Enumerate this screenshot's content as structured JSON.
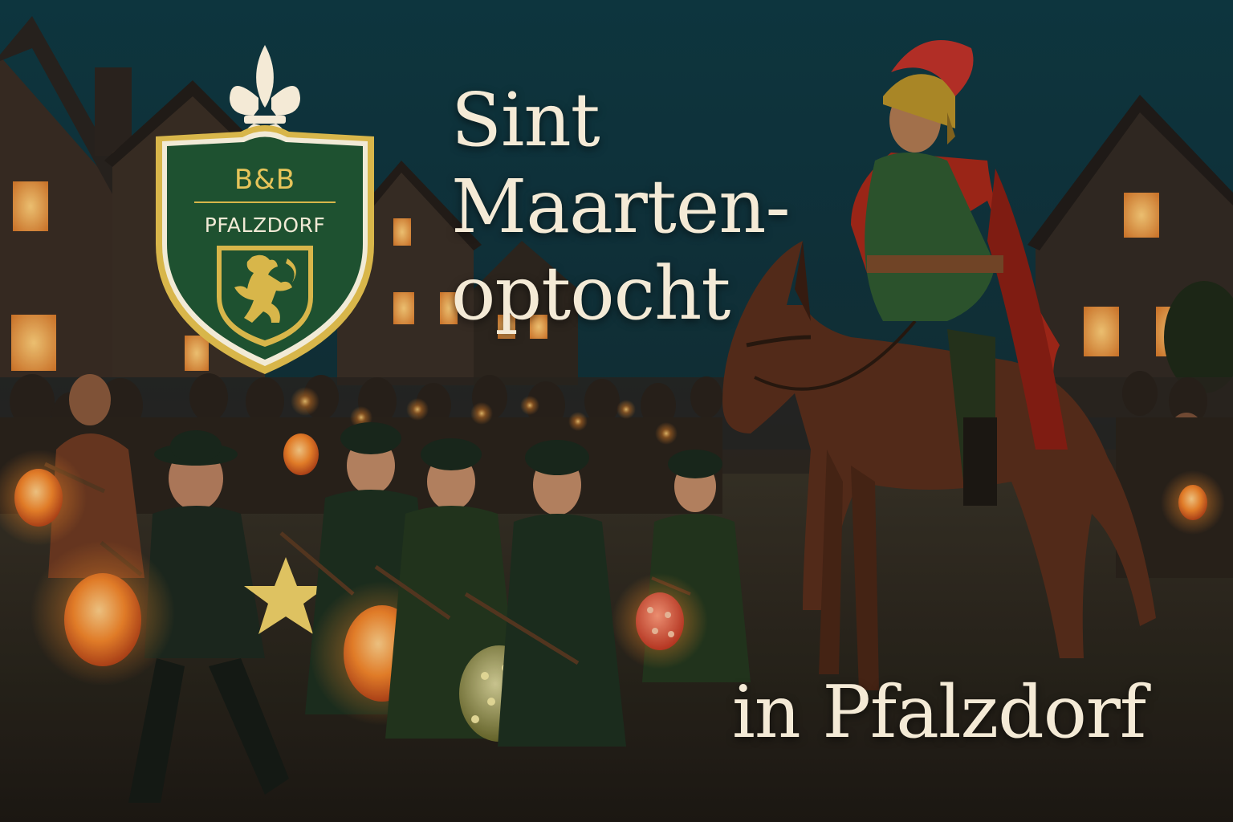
{
  "poster": {
    "title_lines": [
      "Sint",
      "Maarten-",
      "optocht"
    ],
    "subtitle": "in Pfalzdorf"
  },
  "logo": {
    "line1": "B&B",
    "line2": "PFALZDORF",
    "emblem_icon": "fleur-de-lis-icon",
    "crest_icon": "rampant-lion-icon"
  },
  "palette": {
    "night_sky": "#123640",
    "shield_green": "#1e5130",
    "shield_gold": "#d8b64a",
    "lantern_orange": "#f08a2a",
    "title_cream": "#f4ead6"
  }
}
